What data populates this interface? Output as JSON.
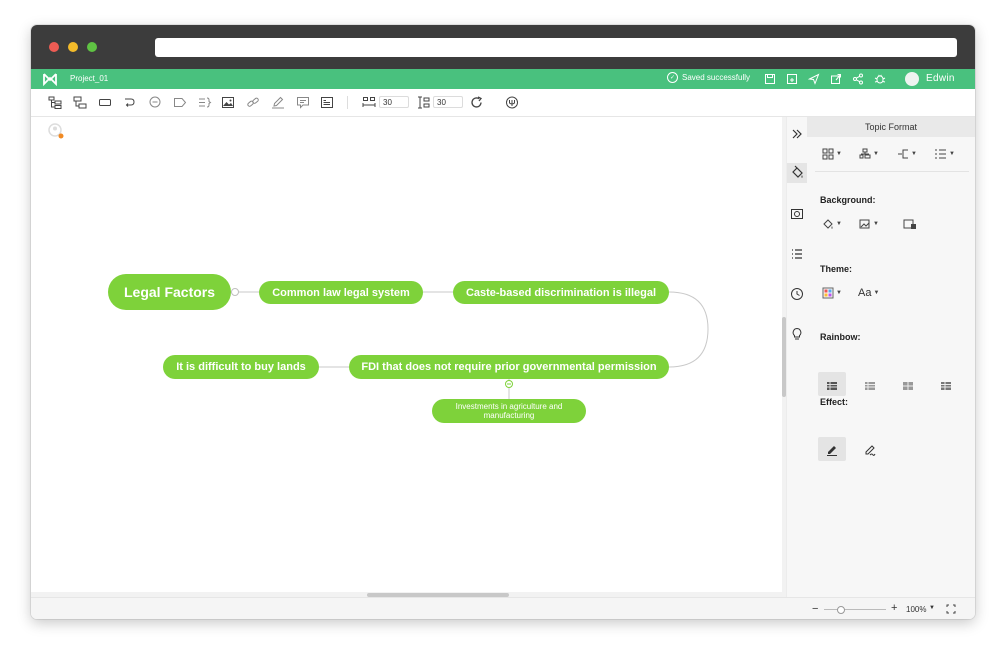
{
  "app": {
    "project_name": "Project_01",
    "save_status": "Saved successfully",
    "user_name": "Edwin",
    "brand_color": "#49c17e"
  },
  "toolbar": {
    "width_value": "30",
    "height_value": "30"
  },
  "mindmap": {
    "node_color": "#7ed23a",
    "root": "Legal Factors",
    "nodes": [
      "Common law legal system",
      "Caste-based discrimination is illegal",
      "FDI that does not require prior governmental permission",
      "It is difficult to buy lands",
      "Investments in agriculture and manufacturing"
    ]
  },
  "panel": {
    "title": "Topic Format",
    "background_label": "Background:",
    "theme_label": "Theme:",
    "theme_font": "Aa",
    "rainbow_label": "Rainbow:",
    "effect_label": "Effect:"
  },
  "status": {
    "zoom": "100%"
  }
}
